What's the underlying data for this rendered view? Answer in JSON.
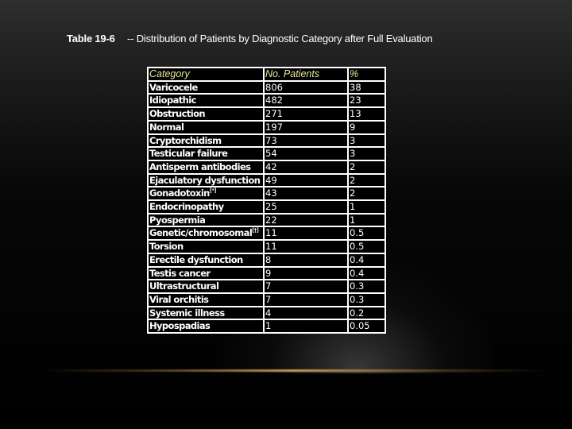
{
  "title": {
    "label": "Table 19-6",
    "text": "-- Distribution of Patients by Diagnostic Category after Full Evaluation"
  },
  "table": {
    "headers": [
      "Category",
      "No. Patients",
      "%"
    ],
    "rows": [
      {
        "category": "Varicocele",
        "note": "",
        "patients": "806",
        "percent": "38"
      },
      {
        "category": "Idiopathic",
        "note": "",
        "patients": "482",
        "percent": "23"
      },
      {
        "category": "Obstruction",
        "note": "",
        "patients": "271",
        "percent": "13"
      },
      {
        "category": "Normal",
        "note": "",
        "patients": "197",
        "percent": "9"
      },
      {
        "category": "Cryptorchidism",
        "note": "",
        "patients": "73",
        "percent": "3"
      },
      {
        "category": "Testicular failure",
        "note": "",
        "patients": "54",
        "percent": "3"
      },
      {
        "category": "Antisperm antibodies",
        "note": "",
        "patients": "42",
        "percent": "2"
      },
      {
        "category": "Ejaculatory dysfunction",
        "note": "",
        "patients": "49",
        "percent": "2"
      },
      {
        "category": "Gonadotoxin",
        "note": "[*]",
        "patients": "43",
        "percent": "2"
      },
      {
        "category": "Endocrinopathy",
        "note": "",
        "patients": "25",
        "percent": "1"
      },
      {
        "category": "Pyospermia",
        "note": "",
        "patients": "22",
        "percent": "1"
      },
      {
        "category": "Genetic/chromosomal",
        "note": "[†]",
        "patients": "11",
        "percent": "0.5"
      },
      {
        "category": "Torsion",
        "note": "",
        "patients": "11",
        "percent": "0.5"
      },
      {
        "category": "Erectile dysfunction",
        "note": "",
        "patients": "8",
        "percent": "0.4"
      },
      {
        "category": "Testis cancer",
        "note": "",
        "patients": "9",
        "percent": "0.4"
      },
      {
        "category": "Ultrastructural",
        "note": "",
        "patients": "7",
        "percent": "0.3"
      },
      {
        "category": "Viral orchitis",
        "note": "",
        "patients": "7",
        "percent": "0.3"
      },
      {
        "category": "Systemic illness",
        "note": "",
        "patients": "4",
        "percent": "0.2"
      },
      {
        "category": "Hypospadias",
        "note": "",
        "patients": "1",
        "percent": "0.05"
      }
    ]
  },
  "colors": {
    "header_text": "#e8e89a",
    "accent_line": "#c89a58"
  }
}
